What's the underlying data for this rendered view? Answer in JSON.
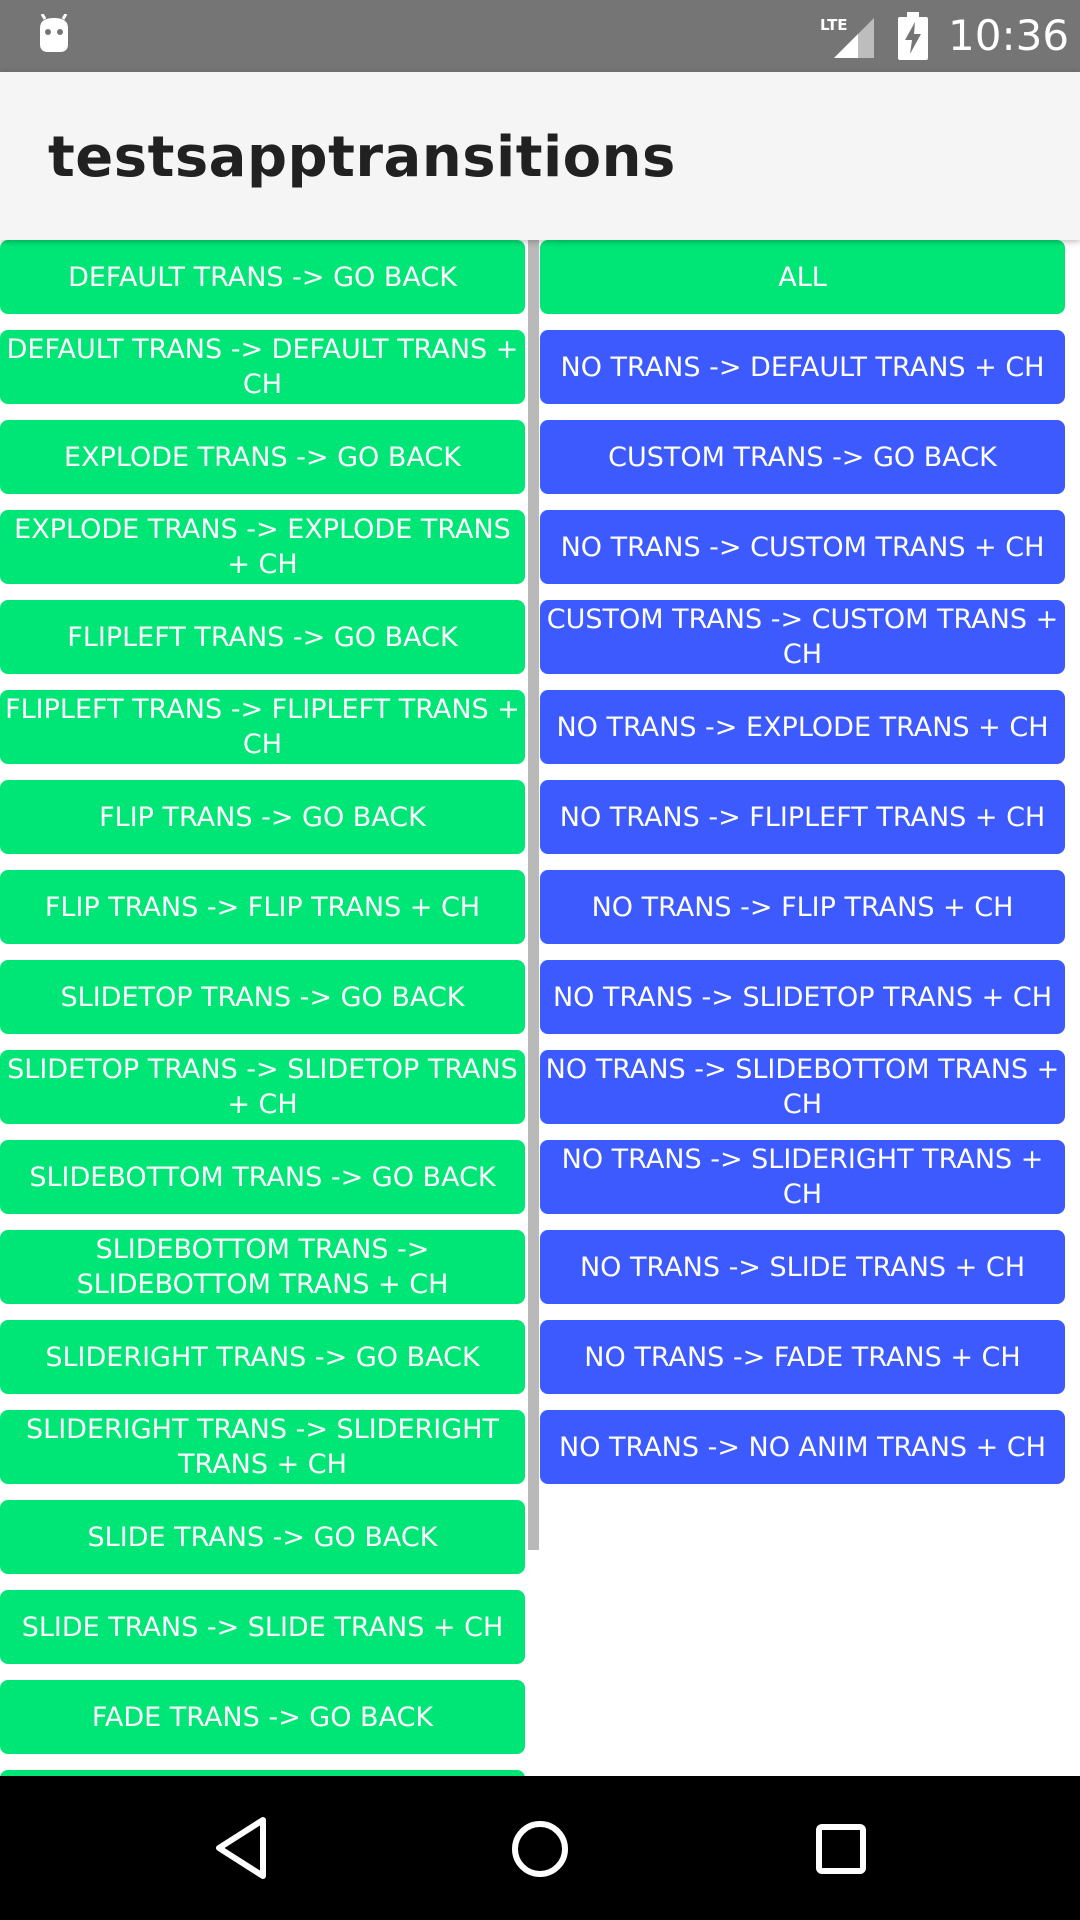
{
  "status_bar": {
    "time": "10:36",
    "network": "LTE"
  },
  "app_bar": {
    "title": "testsapptransitions"
  },
  "colors": {
    "green_button": "#00e676",
    "blue_button": "#3d5afe",
    "status_bar": "#757575",
    "app_bar": "#f5f5f5"
  },
  "left_buttons": [
    "DEFAULT TRANS -> GO BACK",
    "DEFAULT TRANS -> DEFAULT TRANS + CH",
    "EXPLODE TRANS -> GO BACK",
    "EXPLODE TRANS -> EXPLODE TRANS + CH",
    "FLIPLEFT TRANS -> GO BACK",
    "FLIPLEFT TRANS -> FLIPLEFT TRANS + CH",
    "FLIP TRANS -> GO BACK",
    "FLIP TRANS -> FLIP TRANS + CH",
    "SLIDETOP TRANS -> GO BACK",
    "SLIDETOP TRANS -> SLIDETOP TRANS + CH",
    "SLIDEBOTTOM TRANS -> GO BACK",
    "SLIDEBOTTOM TRANS -> SLIDEBOTTOM TRANS + CH",
    "SLIDERIGHT TRANS -> GO BACK",
    "SLIDERIGHT TRANS -> SLIDERIGHT TRANS + CH",
    "SLIDE TRANS -> GO BACK",
    "SLIDE TRANS -> SLIDE TRANS + CH",
    "FADE TRANS -> GO BACK"
  ],
  "right_buttons": [
    "ALL",
    "NO TRANS -> DEFAULT TRANS + CH",
    "CUSTOM TRANS -> GO BACK",
    "NO TRANS -> CUSTOM TRANS + CH",
    "CUSTOM TRANS -> CUSTOM TRANS + CH",
    "NO TRANS -> EXPLODE TRANS + CH",
    "NO TRANS -> FLIPLEFT TRANS + CH",
    "NO TRANS -> FLIP TRANS + CH",
    "NO TRANS -> SLIDETOP TRANS + CH",
    "NO TRANS -> SLIDEBOTTOM TRANS + CH",
    "NO TRANS -> SLIDERIGHT TRANS + CH",
    "NO TRANS -> SLIDE TRANS + CH",
    "NO TRANS -> FADE TRANS + CH",
    "NO TRANS -> NO ANIM TRANS + CH"
  ],
  "nav_icons": [
    "back-icon",
    "home-icon",
    "recent-apps-icon"
  ]
}
